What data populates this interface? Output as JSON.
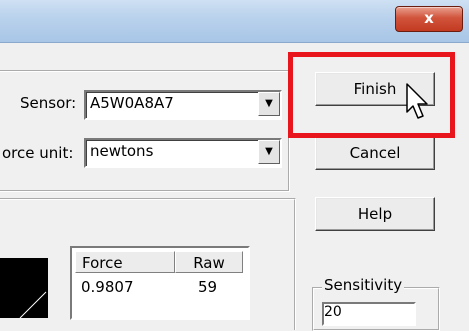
{
  "window": {
    "close_glyph": "x"
  },
  "sensor": {
    "label": "Sensor:",
    "value": "A5W0A8A7"
  },
  "force_unit": {
    "label": "orce unit:",
    "value": "newtons"
  },
  "buttons": {
    "finish": "Finish",
    "cancel": "Cancel",
    "help": "Help"
  },
  "table": {
    "headers": [
      "Force",
      "Raw"
    ],
    "rows": [
      [
        "0.9807",
        "59"
      ]
    ]
  },
  "sensitivity": {
    "label": "Sensitivity",
    "value": "20"
  },
  "colors": {
    "highlight": "#e8161c",
    "close_button": "#c94a33",
    "titlebar": "#b8d1ec"
  },
  "icons": [
    "close-icon",
    "dropdown-arrow-icon",
    "mouse-pointer-icon"
  ]
}
